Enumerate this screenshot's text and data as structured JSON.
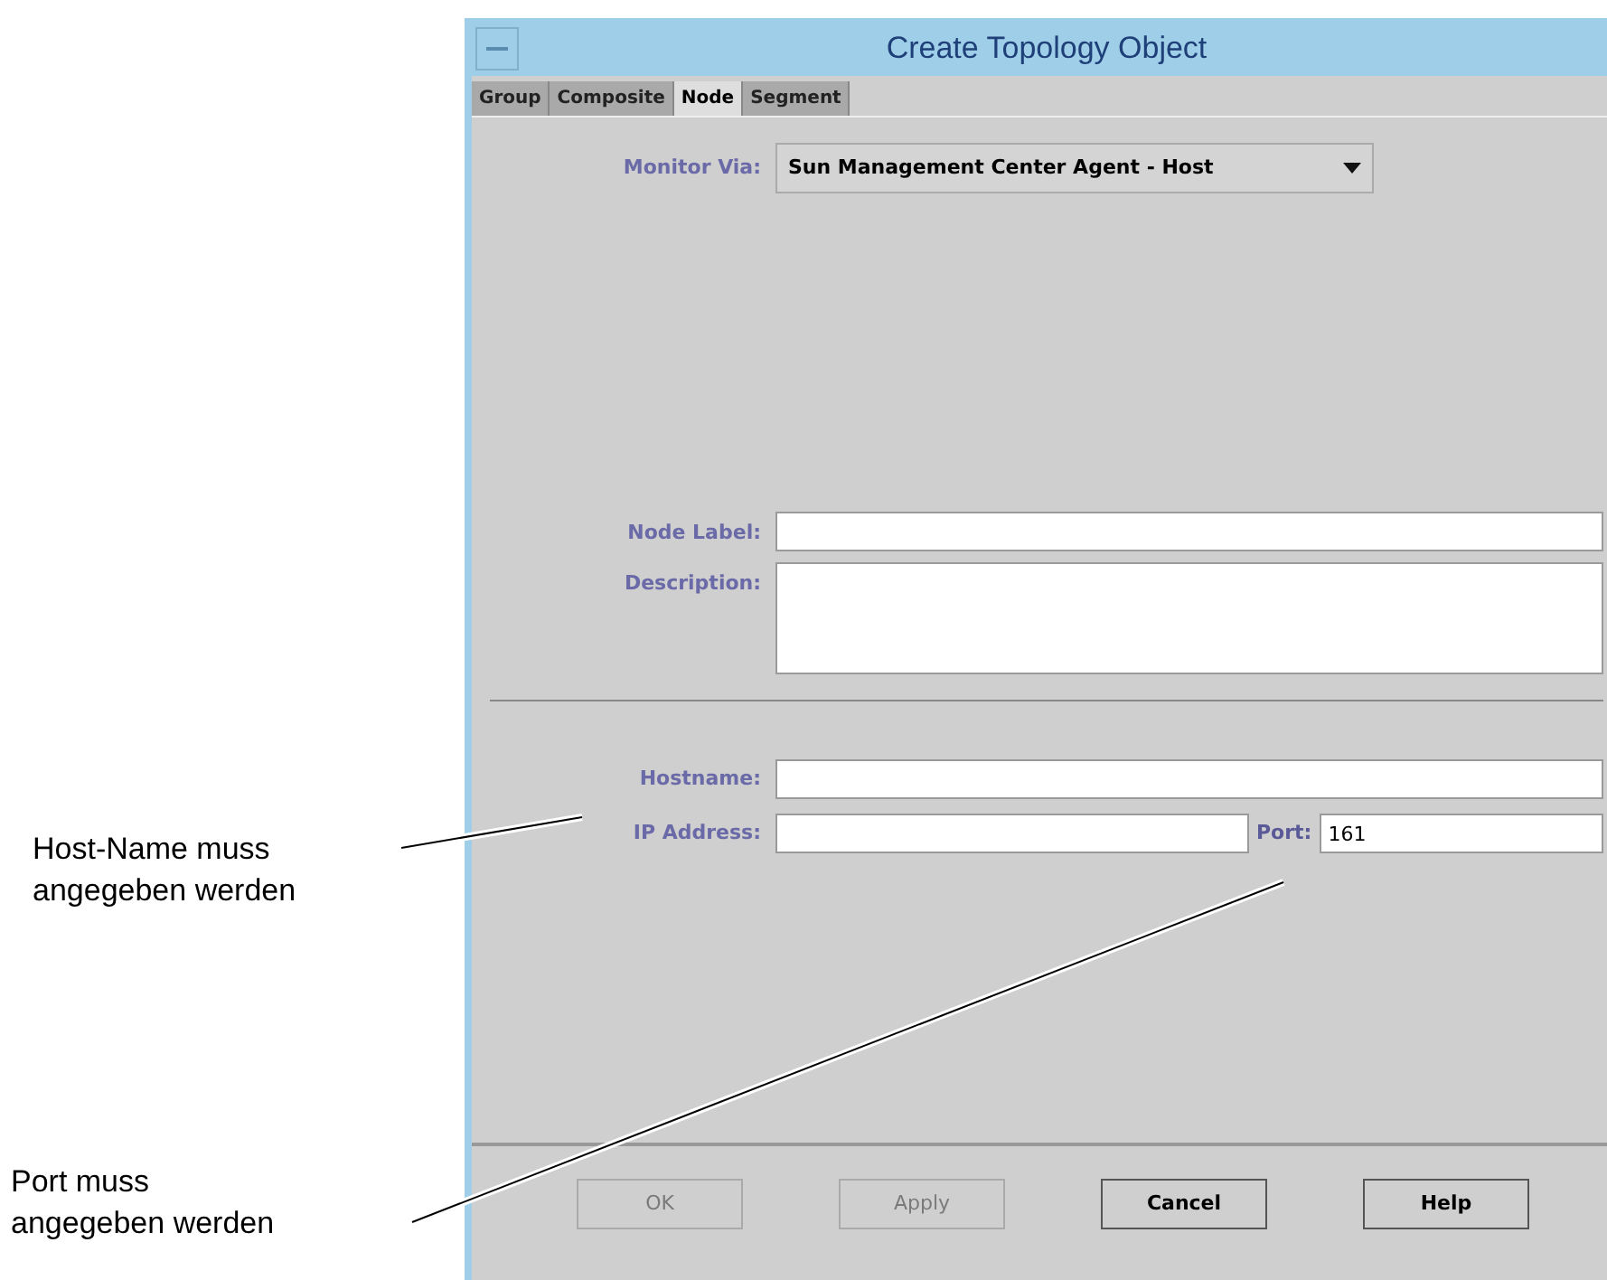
{
  "window": {
    "title": "Create Topology Object"
  },
  "tabs": [
    {
      "label": "Group",
      "selected": false
    },
    {
      "label": "Composite",
      "selected": false
    },
    {
      "label": "Node",
      "selected": true
    },
    {
      "label": "Segment",
      "selected": false
    }
  ],
  "monitor_via": {
    "label": "Monitor Via:",
    "value": "Sun Management Center Agent - Host"
  },
  "node_fields": [
    {
      "label": "Node Label:",
      "kind": "line"
    },
    {
      "label": "Description:",
      "kind": "area"
    }
  ],
  "host_fields": [
    {
      "label": "Hostname:"
    },
    {
      "label": "IP Address:",
      "port": {
        "label": "Port:",
        "value": "161"
      }
    }
  ],
  "buttons": [
    {
      "label": "OK",
      "disabled": true
    },
    {
      "label": "Apply",
      "disabled": true
    },
    {
      "label": "Cancel",
      "disabled": false
    },
    {
      "label": "Help",
      "disabled": false
    }
  ],
  "callouts": [
    {
      "text": "Host-Name muss\nangegeben werden"
    },
    {
      "text": "Port muss\nangegeben werden"
    }
  ]
}
